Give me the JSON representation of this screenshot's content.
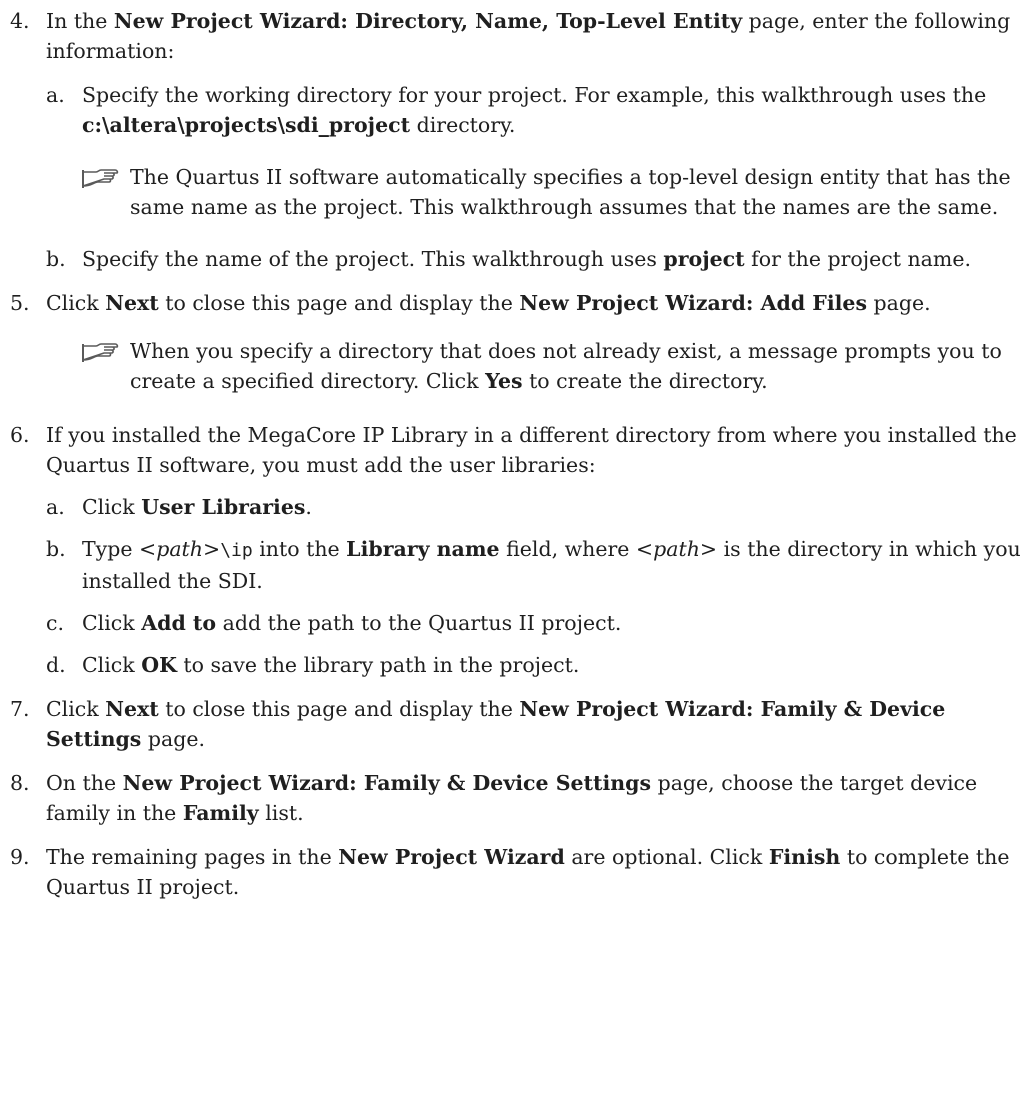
{
  "steps": [
    {
      "num": "4.",
      "parts": [
        "In the ",
        "New Project Wizard: Directory, Name, Top-Level Entity",
        " page, enter the following information:"
      ],
      "subs": [
        {
          "lbl": "a.",
          "parts": [
            "Specify the working directory for your project. For example, this walkthrough uses the ",
            "c:\\altera\\projects\\sdi_project",
            " directory."
          ]
        }
      ],
      "note": "The Quartus II software automatically specifies a top-level design entity that has the same name as the project. This walkthrough assumes that the names are the same.",
      "subs_after": [
        {
          "lbl": "b.",
          "parts": [
            "Specify the name of the project. This walkthrough uses ",
            "project",
            " for the project name."
          ]
        }
      ]
    },
    {
      "num": "5.",
      "parts": [
        "Click ",
        "Next",
        " to close this page and display the ",
        "New Project Wizard: Add Files",
        " page."
      ],
      "note_parts": [
        "When you specify a directory that does not already exist, a message prompts you to create a specified directory. Click ",
        "Yes",
        " to create the directory."
      ]
    },
    {
      "num": "6.",
      "text": "If you installed the MegaCore IP Library in a different directory from where you installed the Quartus II software, you must add the user libraries:",
      "subs": [
        {
          "lbl": "a.",
          "parts": [
            "Click ",
            "User Libraries",
            "."
          ]
        },
        {
          "lbl": "b.",
          "parts": [
            "Type <",
            "path",
            ">",
            "\\ip",
            " into the ",
            "Library name",
            " field, where <",
            "path",
            "> is the directory in which you installed the SDI."
          ]
        },
        {
          "lbl": "c.",
          "parts": [
            "Click ",
            "Add to",
            " add the path to the Quartus II project."
          ]
        },
        {
          "lbl": "d.",
          "parts": [
            "Click ",
            "OK",
            " to save the library path in the project."
          ]
        }
      ]
    },
    {
      "num": "7.",
      "parts": [
        "Click ",
        "Next",
        " to close this page and display the ",
        "New Project Wizard: Family & Device Settings",
        " page."
      ]
    },
    {
      "num": "8.",
      "parts": [
        "On the ",
        "New Project Wizard: Family & Device Settings",
        " page, choose the target device family in the ",
        "Family",
        " list."
      ]
    },
    {
      "num": "9.",
      "parts": [
        "The remaining pages in the ",
        "New Project Wizard",
        " are optional. Click ",
        "Finish",
        " to complete the Quartus II project."
      ]
    }
  ],
  "icons": {
    "note": "pointing-hand-icon"
  },
  "colors": {
    "text": "#1f1f1f",
    "icon": "#5a5a5a"
  }
}
